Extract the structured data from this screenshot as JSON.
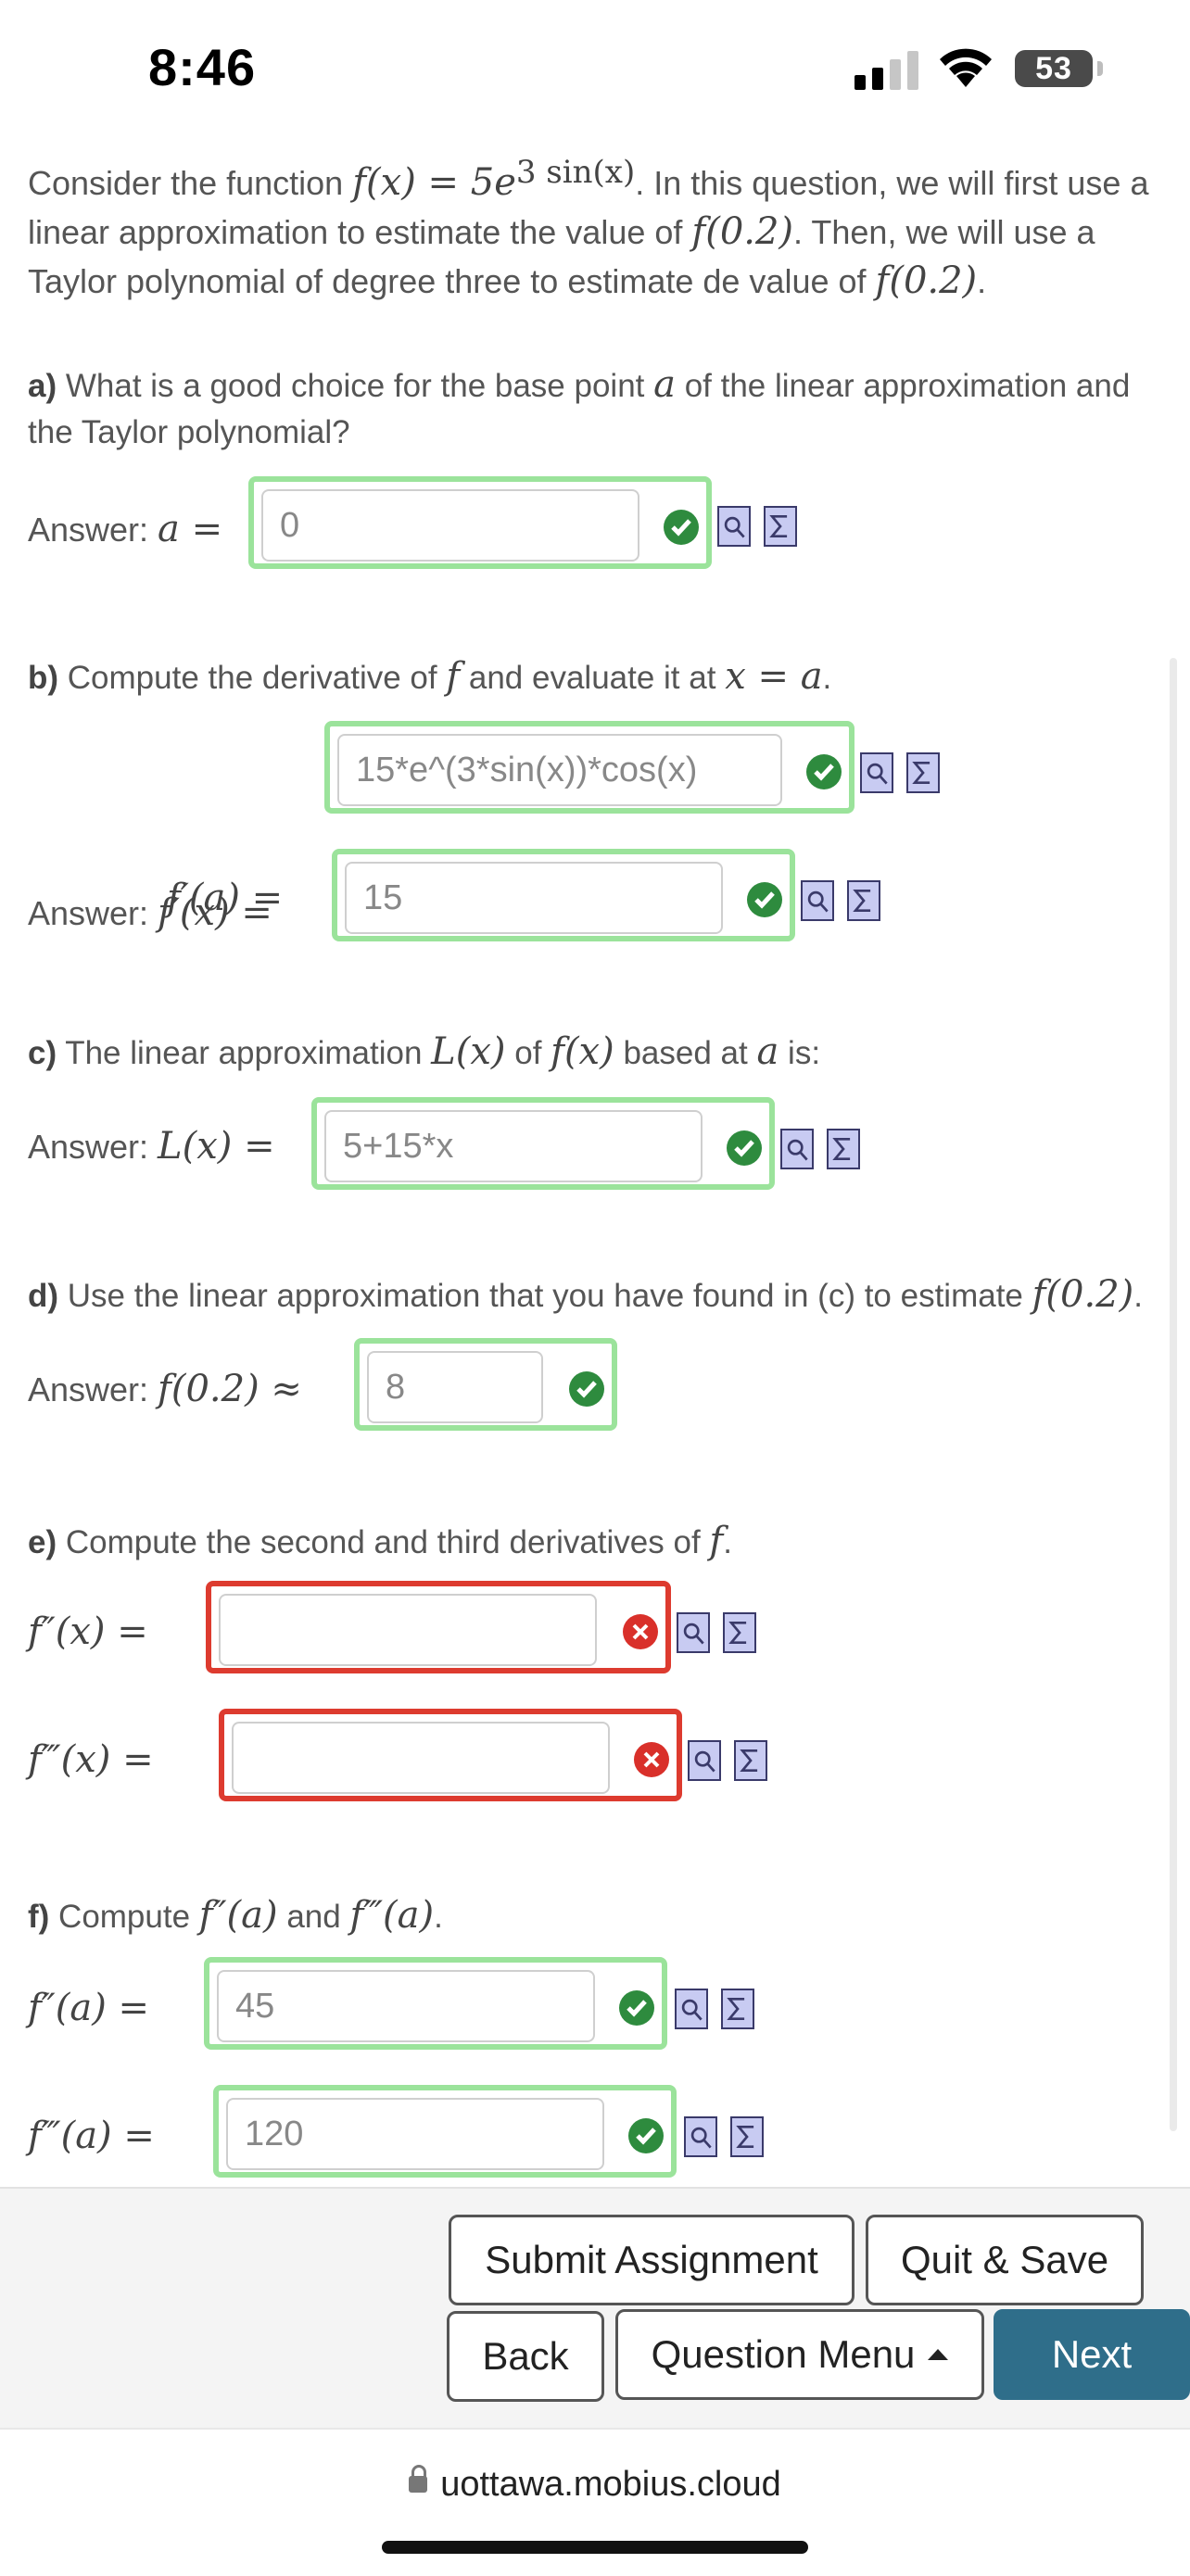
{
  "status": {
    "time": "8:46",
    "battery": "53"
  },
  "intro": {
    "p1": "Consider the function ",
    "fx": "f(x) = 5e",
    "exp": "3 sin(x)",
    "p2": ". In this question, we will first use a linear approximation to estimate the value of ",
    "f02": "f(0.2)",
    "p3": ". Then, we will use a Taylor polynomial of degree three to estimate de value of ",
    "p4": "."
  },
  "qa": {
    "label": "a)",
    "text1": " What is a good choice for the base point ",
    "var": "a",
    "text2": " of the linear approximation and the Taylor polynomial?",
    "answer_prefix": "Answer: ",
    "answer_math": "a =",
    "value": "0"
  },
  "qb": {
    "label": "b)",
    "text1": " Compute the derivative of ",
    "f": "f",
    "text2": " and evaluate it at ",
    "eq": "x = a",
    "text3": ".",
    "answer_prefix": "Answer: ",
    "math1": "f′(x) =",
    "value1": "15*e^(3*sin(x))*cos(x)",
    "math2": "f′(a) =",
    "value2": "15"
  },
  "qc": {
    "label": "c)",
    "text1": " The linear approximation ",
    "Lx": "L(x)",
    "text2": " of ",
    "fx": "f(x)",
    "text3": " based at ",
    "a": "a",
    "text4": " is:",
    "answer_prefix": "Answer: ",
    "math": "L(x) =",
    "value": "5+15*x"
  },
  "qd": {
    "label": "d)",
    "text1": " Use the linear approximation that you have found in (c) to estimate ",
    "f02": "f(0.2)",
    "text2": ".",
    "answer_prefix": "Answer: ",
    "math": "f(0.2) ≈",
    "value": "8"
  },
  "qe": {
    "label": "e)",
    "text1": " Compute the second and third derivatives of ",
    "f": "f",
    "text2": ".",
    "math1": "f″(x) =",
    "value1": "",
    "math2": "f‴(x) =",
    "value2": ""
  },
  "qf": {
    "label": "f)",
    "text1": " Compute ",
    "f2a": "f″(a)",
    "text2": " and ",
    "f3a": "f‴(a)",
    "text3": ".",
    "math1": "f″(a) =",
    "value1": "45",
    "math2": "f‴(a) =",
    "value2": "120"
  },
  "footer": {
    "submit": "Submit Assignment",
    "quit": "Quit & Save",
    "back": "Back",
    "menu": "Question Menu",
    "next": "Next"
  },
  "browser": {
    "url": "uottawa.mobius.cloud"
  },
  "colors": {
    "correct_border": "#9be39b",
    "incorrect_border": "#dd3b2f",
    "next_button": "#2f6e8a"
  }
}
